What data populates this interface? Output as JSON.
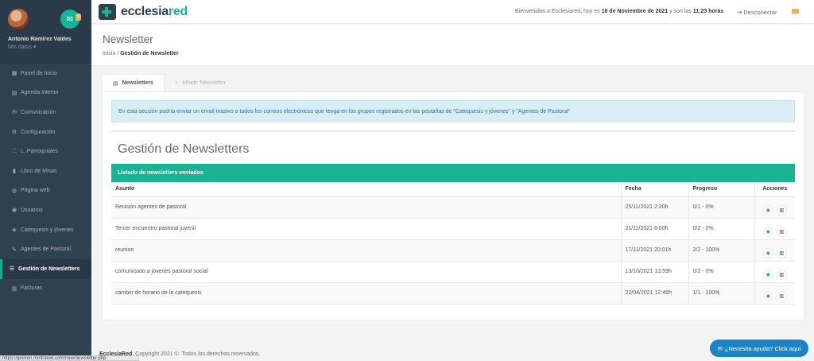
{
  "sidebar": {
    "user_name": "Antonio Ramírez Vaides",
    "user_sub": "Mis datos ▾",
    "mail_count": "0",
    "items": [
      {
        "label": "Panel de Inicio",
        "icon": "▦"
      },
      {
        "label": "Agenda Interior",
        "icon": "▤"
      },
      {
        "label": "Comunicación",
        "icon": "✉"
      },
      {
        "label": "Configuración",
        "icon": "⚙"
      },
      {
        "label": "L. Parroquiales",
        "icon": "⛶"
      },
      {
        "label": "Libro de Misas",
        "icon": "▮"
      },
      {
        "label": "Página web",
        "icon": "◍"
      },
      {
        "label": "Usuarios",
        "icon": "◉"
      },
      {
        "label": "Catequesis y jóvenes",
        "icon": "◈"
      },
      {
        "label": "Agentes de Pastoral",
        "icon": "✎"
      },
      {
        "label": "Gestión de Newsletters",
        "icon": "☰"
      },
      {
        "label": "Facturas",
        "icon": "▥"
      }
    ]
  },
  "topbar": {
    "logo_main": "ecclesia",
    "logo_accent": "red",
    "welcome_prefix": "Bienvenidos a Ecclesiared, hoy es ",
    "welcome_date": "18 de Noviembre de 2021",
    "welcome_mid": " y son las ",
    "welcome_time": "11:23 horas",
    "logout_label": "⇥  Desconectar"
  },
  "heading": {
    "title": "Newsletter",
    "crumb_home": "Inicio",
    "crumb_sep": " / ",
    "crumb_current": "Gestión de Newsletter"
  },
  "tabs": [
    {
      "label": "Newsletters",
      "icon": "▤"
    },
    {
      "label": "Añadir Newsletter",
      "icon": "+"
    }
  ],
  "alert": "En esta sección podría enviar un email masivo a todos los correos electrónicos que tenga en los grupos registrados en las pestañas de \"Catequesis y jóvenes\" y \"Agentes de Pastoral\"",
  "section_title": "Gestión de Newsletters",
  "table": {
    "title": "Listado de newsletters enviados",
    "columns": [
      "Asunto",
      "Fecha",
      "Progreso",
      "Acciones"
    ],
    "rows": [
      {
        "asunto": "Reunión agentes de pastoral",
        "fecha": "25/11/2021 2:30h",
        "progreso": "0/1 - 0%"
      },
      {
        "asunto": "Tercer encuentro pastoral juvenil",
        "fecha": "21/11/2021 8:00h",
        "progreso": "0/2 - 0%"
      },
      {
        "asunto": "reunion",
        "fecha": "17/11/2021 20:01h",
        "progreso": "2/2 - 100%"
      },
      {
        "asunto": "comunicado a jovenes pastoral social",
        "fecha": "13/10/2021 13:59h",
        "progreso": "0/2 - 0%"
      },
      {
        "asunto": "cambio de horario de la catequesis",
        "fecha": "22/04/2021 12:46h",
        "progreso": "1/1 - 100%"
      }
    ]
  },
  "footer": {
    "brand": "EcclesiaRed",
    "text": ", Copyright 2021 ©. Todos los derechos reservados."
  },
  "status_url": "https://gestion.mintrared.com/new/newsletter.php",
  "help_label": "¿Necesita ayuda? Click aquí",
  "colors": {
    "accent": "#1ab394",
    "sidebar": "#2f4050",
    "info": "#1c84c6"
  }
}
